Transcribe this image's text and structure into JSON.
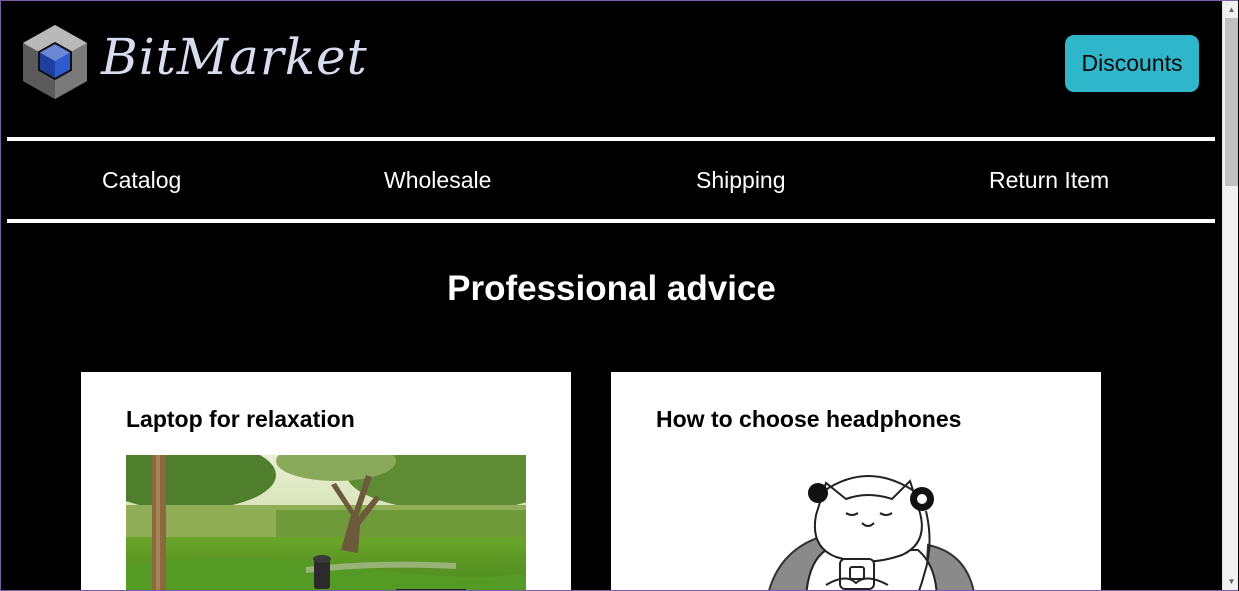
{
  "brand": {
    "name": "BitMarket",
    "logo_icon": "cube-logo-icon"
  },
  "header": {
    "discounts_label": "Discounts"
  },
  "nav": {
    "items": [
      {
        "label": "Catalog"
      },
      {
        "label": "Wholesale"
      },
      {
        "label": "Shipping"
      },
      {
        "label": "Return Item"
      }
    ]
  },
  "main": {
    "title": "Professional advice",
    "cards": [
      {
        "title": "Laptop for relaxation",
        "image": "park-photo"
      },
      {
        "title": "How to choose headphones",
        "image": "cat-headphones-illustration"
      }
    ]
  },
  "scrollbar": {
    "up_icon": "scroll-up-arrow-icon",
    "down_icon": "scroll-down-arrow-icon"
  },
  "colors": {
    "background": "#000000",
    "accent": "#2fb6cb",
    "logo_text": "#d8dcef",
    "card": "#ffffff"
  }
}
